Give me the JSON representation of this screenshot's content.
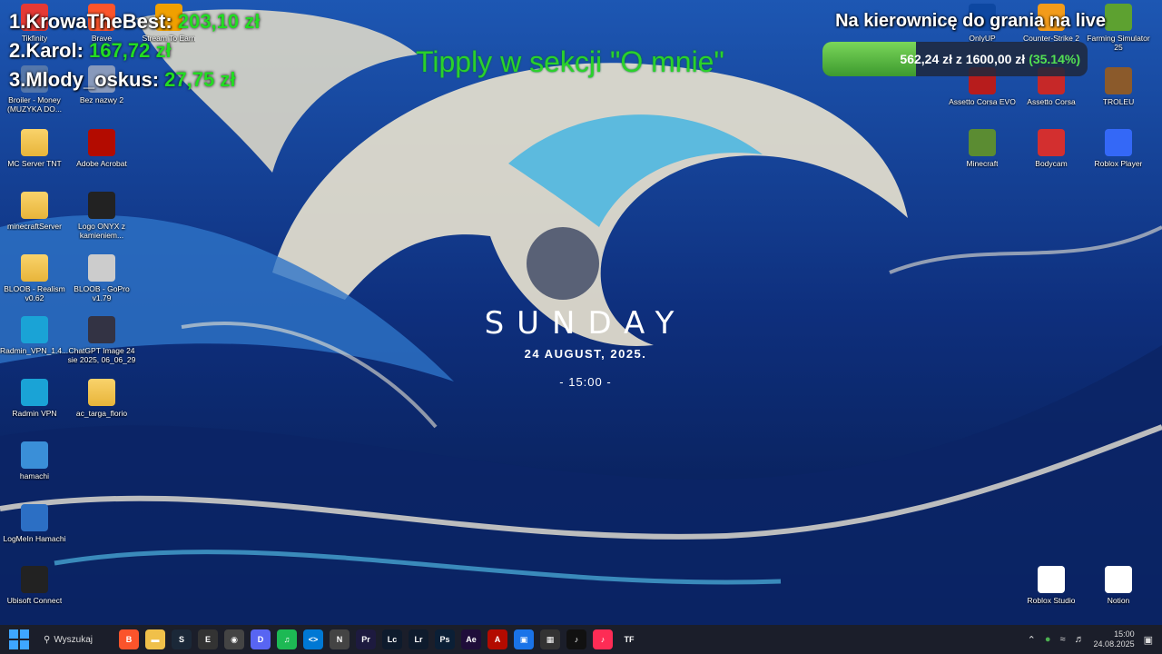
{
  "leaderboard": [
    {
      "name": "1.KrowaTheBest:",
      "amount": "203,10 zł"
    },
    {
      "name": "2.Karol:",
      "amount": "167,72 zł"
    },
    {
      "name": "3.Mlody_oskus:",
      "amount": "27,75 zł"
    }
  ],
  "tip_note": "Tipply w sekcji \"O mnie\"",
  "goal": {
    "title": "Na kierownicę do grania na live",
    "amount": "562,24 zł z 1600,00 zł",
    "percent_label": "(35.14%)",
    "fraction": 0.3514
  },
  "widget": {
    "day": "SUNDAY",
    "date": "24 AUGUST, 2025.",
    "time": "- 15:00 -"
  },
  "desktop_left": [
    {
      "label": "Tikfinity",
      "icon": "tikfinity-icon",
      "color": "#e53935"
    },
    {
      "label": "Brave",
      "icon": "brave-icon",
      "color": "#fb542b"
    },
    {
      "label": "Stream To Earn",
      "icon": "stream-icon",
      "color": "#f0a000"
    },
    {
      "label": "Broiler - Money (MUZYKA DO...",
      "icon": "audio-file-icon",
      "color": "#5577aa"
    },
    {
      "label": "Bez nazwy 2",
      "icon": "file-icon",
      "color": "#8899bb"
    },
    {
      "label": "MC Server TNT",
      "icon": "folder-icon",
      "color": "#f0c04a"
    },
    {
      "label": "Adobe Acrobat",
      "icon": "acrobat-icon",
      "color": "#b30b00"
    },
    {
      "label": "minecraftServer",
      "icon": "folder-icon",
      "color": "#f0c04a"
    },
    {
      "label": "Logo ONYX z kamieniem...",
      "icon": "onyx-icon",
      "color": "#222"
    },
    {
      "label": "BLOOB - Realism v0.62",
      "icon": "folder-icon",
      "color": "#f0c04a"
    },
    {
      "label": "BLOOB - GoPro v1.79",
      "icon": "settings-file-icon",
      "color": "#ccc"
    },
    {
      "label": "Radmin_VPN_1.4....",
      "icon": "radmin-icon",
      "color": "#1aa3d6"
    },
    {
      "label": "ChatGPT Image 24 sie 2025, 06_06_29",
      "icon": "image-icon",
      "color": "#334"
    },
    {
      "label": "Radmin VPN",
      "icon": "radmin-icon",
      "color": "#1aa3d6"
    },
    {
      "label": "ac_targa_florio",
      "icon": "folder-icon",
      "color": "#f0c04a"
    },
    {
      "label": "hamachi",
      "icon": "hamachi-installer-icon",
      "color": "#3a8fd8"
    },
    {
      "label": "LogMeIn Hamachi",
      "icon": "hamachi-icon",
      "color": "#2c6fc4"
    },
    {
      "label": "Ubisoft Connect",
      "icon": "ubisoft-icon",
      "color": "#222"
    }
  ],
  "desktop_right": [
    {
      "label": "OnlyUP",
      "icon": "onlyup-icon",
      "color": "#0d47a1"
    },
    {
      "label": "Counter-Strike 2",
      "icon": "cs2-icon",
      "color": "#f29b1a"
    },
    {
      "label": "Farming Simulator 25",
      "icon": "fs25-icon",
      "color": "#5da130"
    },
    {
      "label": "Assetto Corsa EVO",
      "icon": "ac-evo-icon",
      "color": "#b71c1c"
    },
    {
      "label": "Assetto Corsa",
      "icon": "assetto-icon",
      "color": "#c62828"
    },
    {
      "label": "TROLEU",
      "icon": "troleu-icon",
      "color": "#8b5a2b"
    },
    {
      "label": "Minecraft",
      "icon": "minecraft-icon",
      "color": "#5b8c32"
    },
    {
      "label": "Bodycam",
      "icon": "bodycam-icon",
      "color": "#d32f2f"
    },
    {
      "label": "Roblox Player",
      "icon": "roblox-icon",
      "color": "#3468f7"
    },
    {
      "label": "Roblox Studio",
      "icon": "roblox-studio-icon",
      "color": "#ffffff"
    },
    {
      "label": "Notion",
      "icon": "notion-icon",
      "color": "#ffffff"
    }
  ],
  "taskbar": {
    "search_label": "Wyszukaj",
    "apps": [
      {
        "name": "brave",
        "glyph": "B",
        "color": "#fb542b"
      },
      {
        "name": "file-explorer",
        "glyph": "▬",
        "color": "#f0c04a"
      },
      {
        "name": "steam",
        "glyph": "S",
        "color": "#1b2838"
      },
      {
        "name": "epic",
        "glyph": "E",
        "color": "#333"
      },
      {
        "name": "obs",
        "glyph": "◉",
        "color": "#444"
      },
      {
        "name": "discord",
        "glyph": "D",
        "color": "#5865f2"
      },
      {
        "name": "spotify",
        "glyph": "♫",
        "color": "#1db954"
      },
      {
        "name": "vscode",
        "glyph": "<>",
        "color": "#0078d4"
      },
      {
        "name": "notion",
        "glyph": "N",
        "color": "#444"
      },
      {
        "name": "premiere",
        "glyph": "Pr",
        "color": "#1d1a3f"
      },
      {
        "name": "lightroom-classic",
        "glyph": "Lc",
        "color": "#0e1b2d"
      },
      {
        "name": "lightroom",
        "glyph": "Lr",
        "color": "#0e1b2d"
      },
      {
        "name": "photoshop",
        "glyph": "Ps",
        "color": "#0b1f36"
      },
      {
        "name": "after-effects",
        "glyph": "Ae",
        "color": "#1f0d3a"
      },
      {
        "name": "acrobat",
        "glyph": "A",
        "color": "#b30b00"
      },
      {
        "name": "remote",
        "glyph": "▣",
        "color": "#1a73e8"
      },
      {
        "name": "microsoft-store",
        "glyph": "▦",
        "color": "#333"
      },
      {
        "name": "tiktok",
        "glyph": "♪",
        "color": "#111"
      },
      {
        "name": "tiktok-live",
        "glyph": "♪",
        "color": "#fe2c55"
      },
      {
        "name": "tipply",
        "glyph": "TF",
        "color": "#1b1e2a"
      }
    ],
    "time": "15:00",
    "date": "24.08.2025"
  }
}
